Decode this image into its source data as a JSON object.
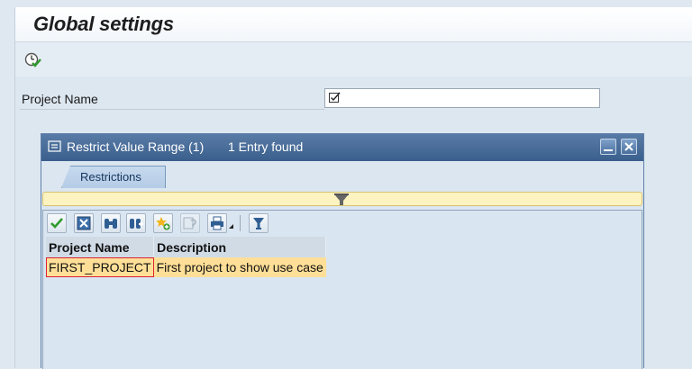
{
  "window": {
    "title": "Global settings"
  },
  "appbar": {
    "execute_icon": "execute-clock-icon"
  },
  "form": {
    "project_name_label": "Project Name",
    "project_name_value": "",
    "input_icon": "checkbox-help-icon"
  },
  "dialog": {
    "title": "Restrict Value Range (1)",
    "status": "1 Entry found",
    "title_icon": "value-help-icon",
    "minimize_icon": "minimize-icon",
    "close_icon": "close-icon",
    "tabs": [
      {
        "label": "Restrictions"
      }
    ],
    "toolbar": [
      {
        "name": "check-icon"
      },
      {
        "name": "cancel-icon"
      },
      {
        "name": "find-icon"
      },
      {
        "name": "find-next-icon"
      },
      {
        "name": "new-entry-icon"
      },
      {
        "name": "help-icon"
      },
      {
        "name": "print-icon"
      },
      {
        "name": "filter-icon"
      }
    ],
    "table": {
      "columns": [
        "Project Name",
        "Description"
      ],
      "rows": [
        [
          "FIRST_PROJECT",
          "First project to show use case"
        ]
      ]
    }
  },
  "colors": {
    "dialog_title_bg": "#3b5f8c",
    "selected_row": "#ffdf97",
    "info_bar": "#fdf3c0"
  }
}
